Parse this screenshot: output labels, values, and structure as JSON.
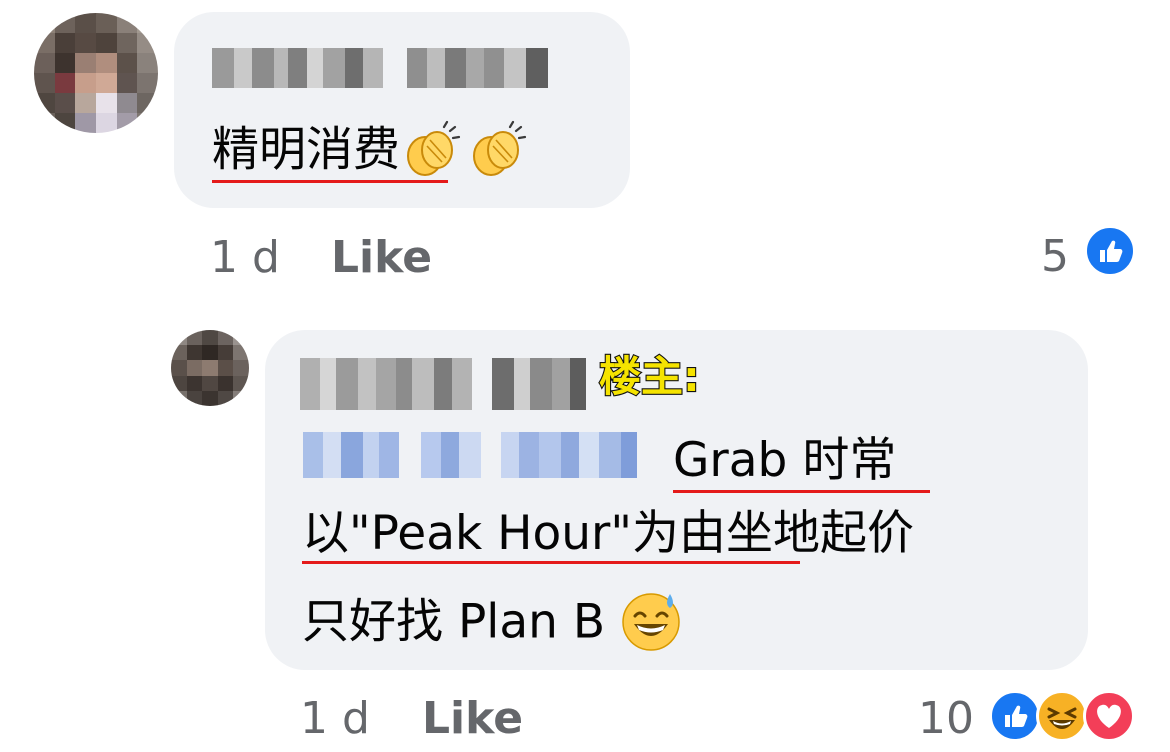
{
  "comments": [
    {
      "author_blurred": true,
      "text": "精明消费",
      "emoji": [
        "clapping-hands",
        "clapping-hands"
      ],
      "time": "1 d",
      "like_label": "Like",
      "reaction_count": "5",
      "reactions": [
        "like"
      ]
    },
    {
      "author_blurred": true,
      "author_badge": "楼主:",
      "mention_blurred": true,
      "lines": [
        "Grab 时常",
        "以\"Peak Hour\"为由坐地起价",
        "只好找 Plan B"
      ],
      "emoji": [
        "grinning-sweat"
      ],
      "time": "1 d",
      "like_label": "Like",
      "reaction_count": "10",
      "reactions": [
        "like",
        "haha",
        "love"
      ]
    }
  ],
  "colors": {
    "bubble": "#f0f2f5",
    "meta_text": "#65676b",
    "underline": "#e41a1a",
    "badge_fill": "#f5e300",
    "like_blue": "#1877f2",
    "love_red": "#f33e58",
    "haha_yellow": "#f7b125"
  }
}
